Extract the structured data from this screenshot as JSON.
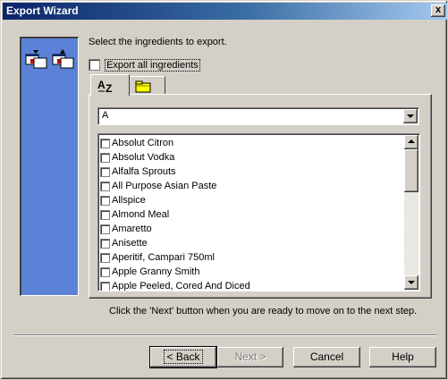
{
  "window": {
    "title": "Export Wizard",
    "close_glyph": "x"
  },
  "intro_text": "Select the ingredients to export.",
  "export_all": {
    "label": "Export all ingredients",
    "checked": false
  },
  "tabs": [
    {
      "label": "AZ",
      "icon": "az-sort-icon",
      "active": true
    },
    {
      "label": "",
      "icon": "folder-icon",
      "active": false
    }
  ],
  "letter_filter": {
    "value": "A"
  },
  "ingredients": [
    "Absolut Citron",
    "Absolut Vodka",
    "Alfalfa Sprouts",
    "All Purpose Asian Paste",
    "Allspice",
    "Almond Meal",
    "Amaretto",
    "Anisette",
    "Aperitif, Campari  750ml",
    "Apple Granny Smith",
    "Apple Peeled, Cored And Diced"
  ],
  "hint_text": "Click the 'Next' button when you are ready to move on to the next step.",
  "buttons": {
    "back": "< Back",
    "next": "Next >",
    "cancel": "Cancel",
    "help": "Help"
  },
  "colors": {
    "title_gradient_start": "#0a246a",
    "title_gradient_end": "#a6caf0",
    "side_panel": "#5b82d6",
    "dialog_face": "#d4d0c8"
  }
}
